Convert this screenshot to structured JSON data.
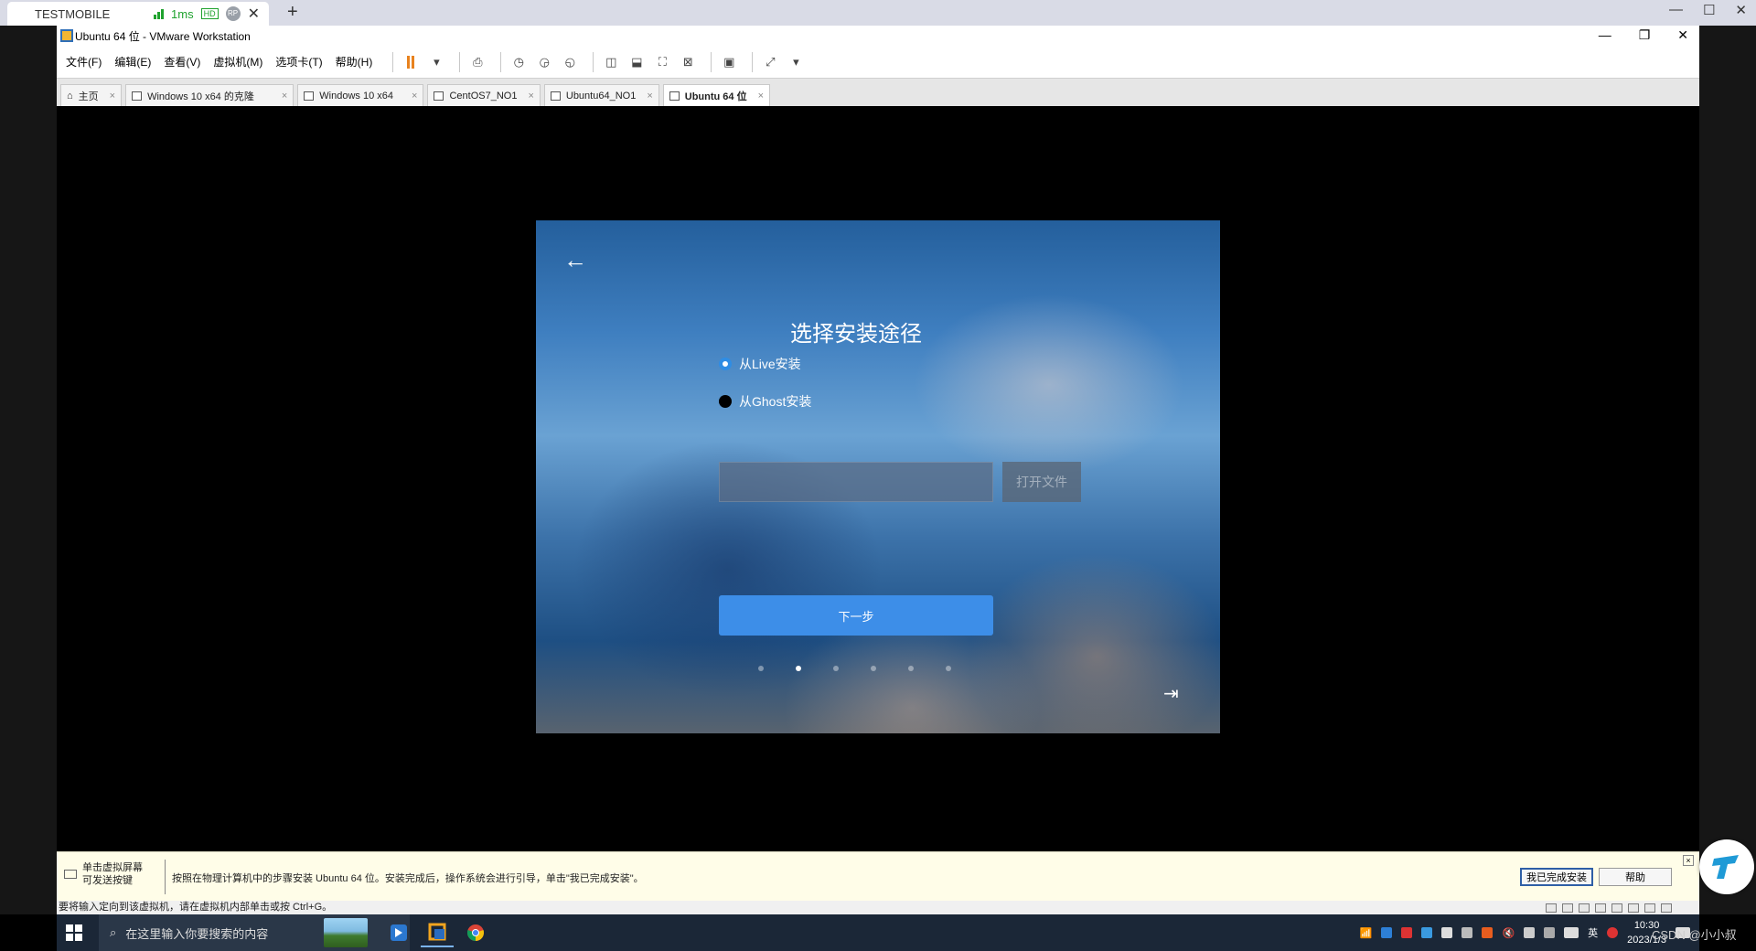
{
  "remote": {
    "tab_title": "TESTMOBILE",
    "latency": "1ms",
    "hd_badge": "HD",
    "rp_badge": "RP",
    "close_glyph": "✕",
    "new_tab_glyph": "+",
    "ctrl_min": "—",
    "ctrl_max": "☐",
    "ctrl_close": "✕"
  },
  "vmware": {
    "window_title": "Ubuntu 64 位 - VMware Workstation",
    "ctrl_min": "—",
    "ctrl_restore": "❐",
    "ctrl_close": "✕",
    "menu": [
      "文件(F)",
      "编辑(E)",
      "查看(V)",
      "虚拟机(M)",
      "选项卡(T)",
      "帮助(H)"
    ],
    "tabs": [
      {
        "label": "主页",
        "icon": "home-icon"
      },
      {
        "label": "Windows 10 x64 的克隆",
        "icon": "vm-icon"
      },
      {
        "label": "Windows 10 x64",
        "icon": "vm-icon"
      },
      {
        "label": "CentOS7_NO1",
        "icon": "vm-icon"
      },
      {
        "label": "Ubuntu64_NO1",
        "icon": "vm-icon"
      },
      {
        "label": "Ubuntu 64 位",
        "icon": "vm-icon",
        "active": true
      }
    ],
    "tab_close_glyph": "×"
  },
  "installer": {
    "back_glyph": "←",
    "title": "选择安装途径",
    "option_live": "从Live安装",
    "option_ghost": "从Ghost安装",
    "ghost_path_value": "",
    "open_file_label": "打开文件",
    "next_label": "下一步",
    "steps_total": 6,
    "step_current": 2,
    "exit_glyph": "⇥"
  },
  "hint": {
    "side_line1": "单击虚拟屏幕",
    "side_line2": "可发送按键",
    "message": "按照在物理计算机中的步骤安装 Ubuntu 64 位。安装完成后，操作系统会进行引导，单击\"我已完成安装\"。",
    "done_label": "我已完成安装",
    "help_label": "帮助",
    "close_glyph": "×"
  },
  "status_text": "要将输入定向到该虚拟机，请在虚拟机内部单击或按 Ctrl+G。",
  "taskbar": {
    "search_placeholder": "在这里输入你要搜索的内容",
    "search_glyph": "⌕",
    "ime": "英",
    "time": "10:30",
    "date": "2023/1/3",
    "watermark": "CSDN @小小叔"
  },
  "colors": {
    "accent": "#3d8ee8",
    "taskbar": "#1b2737",
    "hint_bg": "#fffde8"
  }
}
